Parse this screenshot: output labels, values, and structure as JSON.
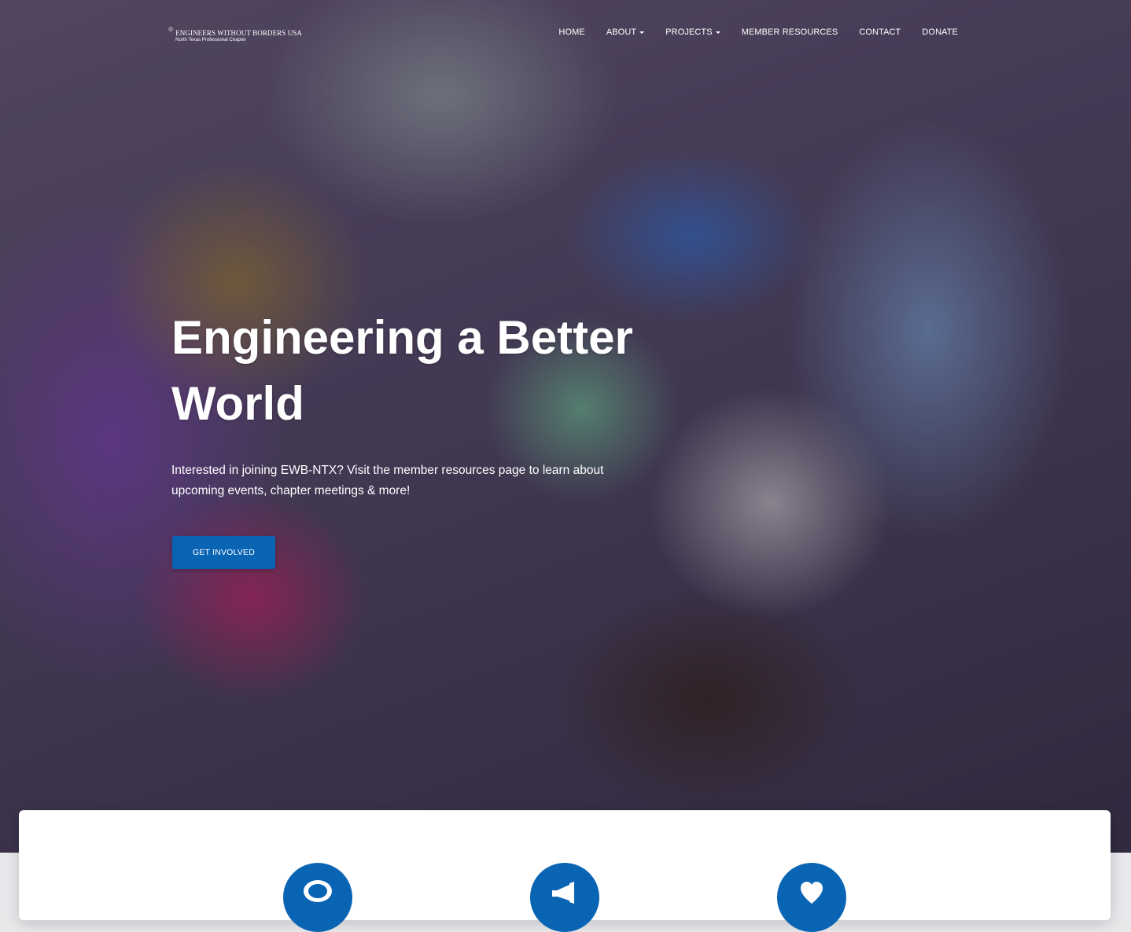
{
  "logo": {
    "title": "ENGINEERS WITHOUT BORDERS USA",
    "subtitle": "North Texas Professional Chapter",
    "icon": "globe-icon"
  },
  "nav": {
    "items": [
      {
        "label": "HOME",
        "dropdown": false
      },
      {
        "label": "ABOUT",
        "dropdown": true
      },
      {
        "label": "PROJECTS",
        "dropdown": true
      },
      {
        "label": "MEMBER RESOURCES",
        "dropdown": false
      },
      {
        "label": "CONTACT",
        "dropdown": false
      },
      {
        "label": "DONATE",
        "dropdown": false
      }
    ]
  },
  "hero": {
    "title": "Engineering a Better World",
    "text": "Interested in joining EWB-NTX? Visit the member resources page to learn about upcoming events, chapter meetings & more!",
    "button_label": "GET INVOLVED"
  },
  "features": {
    "icons": [
      "chat-icon",
      "megaphone-icon",
      "heart-icon"
    ]
  },
  "colors": {
    "accent": "#0a64b4",
    "card_bg": "#ffffff",
    "page_bg": "#e9e9ec"
  }
}
